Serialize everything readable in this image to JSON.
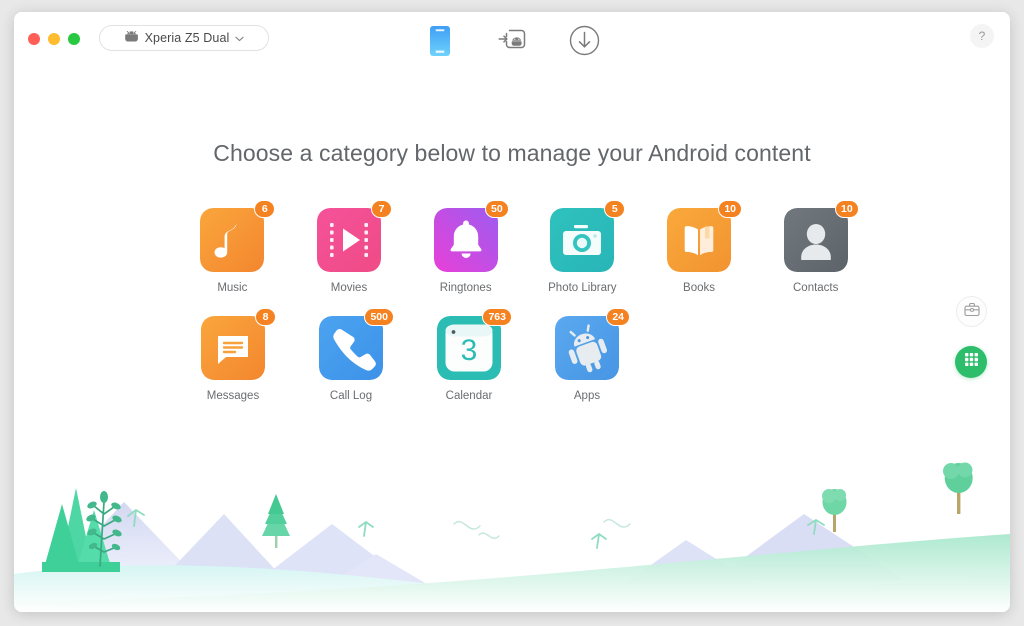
{
  "window": {
    "traffic_lights": [
      {
        "name": "close",
        "color": "#ff5f57"
      },
      {
        "name": "minimize",
        "color": "#febc2e"
      },
      {
        "name": "zoom",
        "color": "#28c840"
      }
    ]
  },
  "titlebar": {
    "device": {
      "icon": "android-head-icon",
      "name": "Xperia Z5 Dual",
      "chevron": "chevron-down-icon"
    },
    "tools": [
      {
        "name": "phone-tab",
        "icon": "phone-icon",
        "active": true
      },
      {
        "name": "import-android-tab",
        "icon": "android-import-icon",
        "active": false
      },
      {
        "name": "download-tab",
        "icon": "download-circle-icon",
        "active": false
      }
    ],
    "help_label": "?"
  },
  "main": {
    "heading": "Choose a category below to manage your Android content",
    "rows": [
      [
        {
          "id": "music",
          "label": "Music",
          "badge": "6",
          "icon": "music-note-icon"
        },
        {
          "id": "movies",
          "label": "Movies",
          "badge": "7",
          "icon": "film-play-icon"
        },
        {
          "id": "ringtones",
          "label": "Ringtones",
          "badge": "50",
          "icon": "bell-icon"
        },
        {
          "id": "photo-library",
          "label": "Photo Library",
          "badge": "5",
          "icon": "camera-icon"
        },
        {
          "id": "books",
          "label": "Books",
          "badge": "10",
          "icon": "open-book-icon"
        },
        {
          "id": "contacts",
          "label": "Contacts",
          "badge": "10",
          "icon": "person-icon"
        }
      ],
      [
        {
          "id": "messages",
          "label": "Messages",
          "badge": "8",
          "icon": "speech-bubble-icon"
        },
        {
          "id": "call-log",
          "label": "Call Log",
          "badge": "500",
          "icon": "handset-icon"
        },
        {
          "id": "calendar",
          "label": "Calendar",
          "badge": "763",
          "icon": "calendar-icon",
          "day": "3"
        },
        {
          "id": "apps",
          "label": "Apps",
          "badge": "24",
          "icon": "android-robot-icon"
        }
      ]
    ]
  },
  "side_buttons": [
    {
      "name": "toolbox-button",
      "icon": "toolbox-icon"
    },
    {
      "name": "apps-grid-button",
      "icon": "grid-icon",
      "color": "#2ebd6b"
    }
  ],
  "colors": {
    "badge": "#f58220",
    "heading": "#63666a",
    "accent_green": "#2ebd6b"
  }
}
